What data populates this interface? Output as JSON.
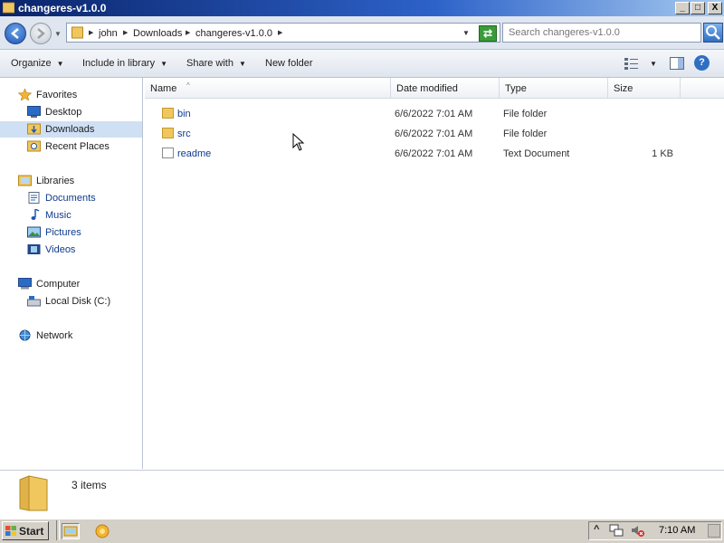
{
  "window": {
    "title": "changeres-v1.0.0"
  },
  "caption_buttons": {
    "minimize": "_",
    "maximize": "□",
    "close": "X"
  },
  "address": {
    "breadcrumbs": [
      "john",
      "Downloads",
      "changeres-v1.0.0"
    ]
  },
  "search": {
    "placeholder": "Search changeres-v1.0.0"
  },
  "commandbar": {
    "organize": "Organize",
    "include_in_library": "Include in library",
    "share_with": "Share with",
    "new_folder": "New folder"
  },
  "navigation": {
    "favorites": {
      "label": "Favorites",
      "items": [
        "Desktop",
        "Downloads",
        "Recent Places"
      ]
    },
    "libraries": {
      "label": "Libraries",
      "items": [
        "Documents",
        "Music",
        "Pictures",
        "Videos"
      ]
    },
    "computer": {
      "label": "Computer",
      "items": [
        "Local Disk (C:)"
      ]
    },
    "network": {
      "label": "Network"
    }
  },
  "columns": {
    "name": "Name",
    "date_modified": "Date modified",
    "type": "Type",
    "size": "Size"
  },
  "files": [
    {
      "name": "bin",
      "date": "6/6/2022 7:01 AM",
      "type": "File folder",
      "size": "",
      "icon": "folder-icon"
    },
    {
      "name": "src",
      "date": "6/6/2022 7:01 AM",
      "type": "File folder",
      "size": "",
      "icon": "folder-icon"
    },
    {
      "name": "readme",
      "date": "6/6/2022 7:01 AM",
      "type": "Text Document",
      "size": "1 KB",
      "icon": "text-document-icon"
    }
  ],
  "details": {
    "count": "3 items"
  },
  "taskbar": {
    "start": "Start",
    "clock": "7:10 AM"
  },
  "colors": {
    "title_bar": "#0a246a",
    "link_text": "#0e3a8e",
    "selection": "#cfe0f4",
    "taskbar": "#d4d0c8"
  }
}
